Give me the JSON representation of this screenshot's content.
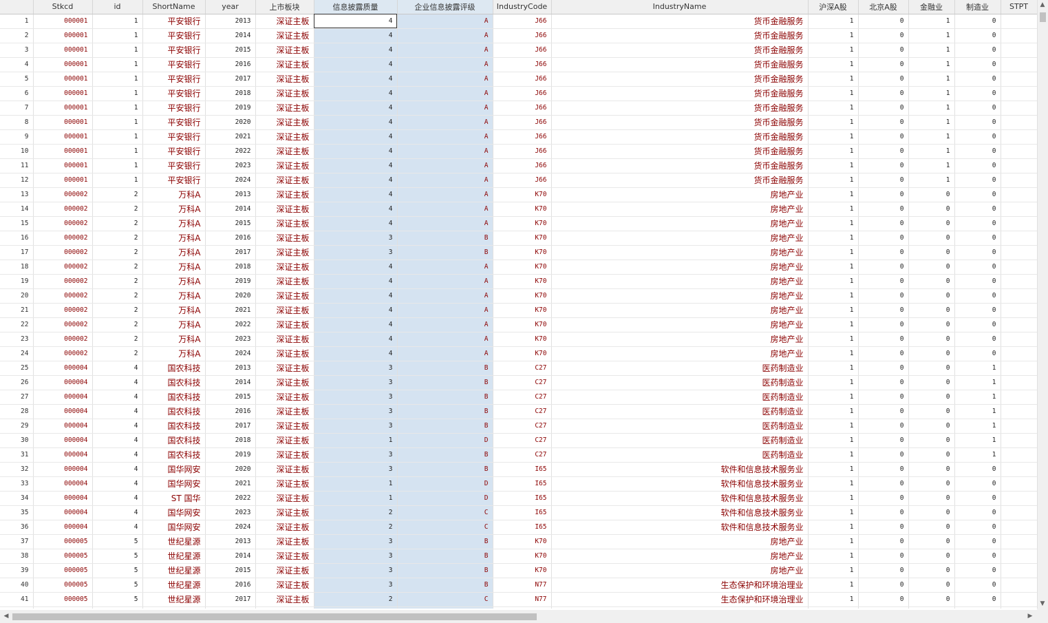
{
  "columns": [
    {
      "key": "rownum",
      "label": ""
    },
    {
      "key": "Stkcd",
      "label": "Stkcd"
    },
    {
      "key": "id",
      "label": "id"
    },
    {
      "key": "ShortName",
      "label": "ShortName"
    },
    {
      "key": "year",
      "label": "year"
    },
    {
      "key": "board",
      "label": "上市板块"
    },
    {
      "key": "quality",
      "label": "信息披露质量"
    },
    {
      "key": "rating",
      "label": "企业信息披露评级"
    },
    {
      "key": "IndustryCode",
      "label": "IndustryCode"
    },
    {
      "key": "IndustryName",
      "label": "IndustryName"
    },
    {
      "key": "hushen",
      "label": "沪深A股"
    },
    {
      "key": "beijing",
      "label": "北京A股"
    },
    {
      "key": "finance",
      "label": "金融业"
    },
    {
      "key": "manufacturing",
      "label": "制造业"
    },
    {
      "key": "STPT",
      "label": "STPT"
    }
  ],
  "selected_columns": [
    "quality",
    "rating"
  ],
  "active_cell": {
    "row": 1,
    "col": "quality"
  },
  "rows": [
    [
      "1",
      "000001",
      "1",
      "平安银行",
      "2013",
      "深证主板",
      "4",
      "A",
      "J66",
      "货币金融服务",
      "1",
      "0",
      "1",
      "0",
      ""
    ],
    [
      "2",
      "000001",
      "1",
      "平安银行",
      "2014",
      "深证主板",
      "4",
      "A",
      "J66",
      "货币金融服务",
      "1",
      "0",
      "1",
      "0",
      ""
    ],
    [
      "3",
      "000001",
      "1",
      "平安银行",
      "2015",
      "深证主板",
      "4",
      "A",
      "J66",
      "货币金融服务",
      "1",
      "0",
      "1",
      "0",
      ""
    ],
    [
      "4",
      "000001",
      "1",
      "平安银行",
      "2016",
      "深证主板",
      "4",
      "A",
      "J66",
      "货币金融服务",
      "1",
      "0",
      "1",
      "0",
      ""
    ],
    [
      "5",
      "000001",
      "1",
      "平安银行",
      "2017",
      "深证主板",
      "4",
      "A",
      "J66",
      "货币金融服务",
      "1",
      "0",
      "1",
      "0",
      ""
    ],
    [
      "6",
      "000001",
      "1",
      "平安银行",
      "2018",
      "深证主板",
      "4",
      "A",
      "J66",
      "货币金融服务",
      "1",
      "0",
      "1",
      "0",
      ""
    ],
    [
      "7",
      "000001",
      "1",
      "平安银行",
      "2019",
      "深证主板",
      "4",
      "A",
      "J66",
      "货币金融服务",
      "1",
      "0",
      "1",
      "0",
      ""
    ],
    [
      "8",
      "000001",
      "1",
      "平安银行",
      "2020",
      "深证主板",
      "4",
      "A",
      "J66",
      "货币金融服务",
      "1",
      "0",
      "1",
      "0",
      ""
    ],
    [
      "9",
      "000001",
      "1",
      "平安银行",
      "2021",
      "深证主板",
      "4",
      "A",
      "J66",
      "货币金融服务",
      "1",
      "0",
      "1",
      "0",
      ""
    ],
    [
      "10",
      "000001",
      "1",
      "平安银行",
      "2022",
      "深证主板",
      "4",
      "A",
      "J66",
      "货币金融服务",
      "1",
      "0",
      "1",
      "0",
      ""
    ],
    [
      "11",
      "000001",
      "1",
      "平安银行",
      "2023",
      "深证主板",
      "4",
      "A",
      "J66",
      "货币金融服务",
      "1",
      "0",
      "1",
      "0",
      ""
    ],
    [
      "12",
      "000001",
      "1",
      "平安银行",
      "2024",
      "深证主板",
      "4",
      "A",
      "J66",
      "货币金融服务",
      "1",
      "0",
      "1",
      "0",
      ""
    ],
    [
      "13",
      "000002",
      "2",
      "万科A",
      "2013",
      "深证主板",
      "4",
      "A",
      "K70",
      "房地产业",
      "1",
      "0",
      "0",
      "0",
      ""
    ],
    [
      "14",
      "000002",
      "2",
      "万科A",
      "2014",
      "深证主板",
      "4",
      "A",
      "K70",
      "房地产业",
      "1",
      "0",
      "0",
      "0",
      ""
    ],
    [
      "15",
      "000002",
      "2",
      "万科A",
      "2015",
      "深证主板",
      "4",
      "A",
      "K70",
      "房地产业",
      "1",
      "0",
      "0",
      "0",
      ""
    ],
    [
      "16",
      "000002",
      "2",
      "万科A",
      "2016",
      "深证主板",
      "3",
      "B",
      "K70",
      "房地产业",
      "1",
      "0",
      "0",
      "0",
      ""
    ],
    [
      "17",
      "000002",
      "2",
      "万科A",
      "2017",
      "深证主板",
      "3",
      "B",
      "K70",
      "房地产业",
      "1",
      "0",
      "0",
      "0",
      ""
    ],
    [
      "18",
      "000002",
      "2",
      "万科A",
      "2018",
      "深证主板",
      "4",
      "A",
      "K70",
      "房地产业",
      "1",
      "0",
      "0",
      "0",
      ""
    ],
    [
      "19",
      "000002",
      "2",
      "万科A",
      "2019",
      "深证主板",
      "4",
      "A",
      "K70",
      "房地产业",
      "1",
      "0",
      "0",
      "0",
      ""
    ],
    [
      "20",
      "000002",
      "2",
      "万科A",
      "2020",
      "深证主板",
      "4",
      "A",
      "K70",
      "房地产业",
      "1",
      "0",
      "0",
      "0",
      ""
    ],
    [
      "21",
      "000002",
      "2",
      "万科A",
      "2021",
      "深证主板",
      "4",
      "A",
      "K70",
      "房地产业",
      "1",
      "0",
      "0",
      "0",
      ""
    ],
    [
      "22",
      "000002",
      "2",
      "万科A",
      "2022",
      "深证主板",
      "4",
      "A",
      "K70",
      "房地产业",
      "1",
      "0",
      "0",
      "0",
      ""
    ],
    [
      "23",
      "000002",
      "2",
      "万科A",
      "2023",
      "深证主板",
      "4",
      "A",
      "K70",
      "房地产业",
      "1",
      "0",
      "0",
      "0",
      ""
    ],
    [
      "24",
      "000002",
      "2",
      "万科A",
      "2024",
      "深证主板",
      "4",
      "A",
      "K70",
      "房地产业",
      "1",
      "0",
      "0",
      "0",
      ""
    ],
    [
      "25",
      "000004",
      "4",
      "国农科技",
      "2013",
      "深证主板",
      "3",
      "B",
      "C27",
      "医药制造业",
      "1",
      "0",
      "0",
      "1",
      ""
    ],
    [
      "26",
      "000004",
      "4",
      "国农科技",
      "2014",
      "深证主板",
      "3",
      "B",
      "C27",
      "医药制造业",
      "1",
      "0",
      "0",
      "1",
      ""
    ],
    [
      "27",
      "000004",
      "4",
      "国农科技",
      "2015",
      "深证主板",
      "3",
      "B",
      "C27",
      "医药制造业",
      "1",
      "0",
      "0",
      "1",
      ""
    ],
    [
      "28",
      "000004",
      "4",
      "国农科技",
      "2016",
      "深证主板",
      "3",
      "B",
      "C27",
      "医药制造业",
      "1",
      "0",
      "0",
      "1",
      ""
    ],
    [
      "29",
      "000004",
      "4",
      "国农科技",
      "2017",
      "深证主板",
      "3",
      "B",
      "C27",
      "医药制造业",
      "1",
      "0",
      "0",
      "1",
      ""
    ],
    [
      "30",
      "000004",
      "4",
      "国农科技",
      "2018",
      "深证主板",
      "1",
      "D",
      "C27",
      "医药制造业",
      "1",
      "0",
      "0",
      "1",
      ""
    ],
    [
      "31",
      "000004",
      "4",
      "国农科技",
      "2019",
      "深证主板",
      "3",
      "B",
      "C27",
      "医药制造业",
      "1",
      "0",
      "0",
      "1",
      ""
    ],
    [
      "32",
      "000004",
      "4",
      "国华网安",
      "2020",
      "深证主板",
      "3",
      "B",
      "I65",
      "软件和信息技术服务业",
      "1",
      "0",
      "0",
      "0",
      ""
    ],
    [
      "33",
      "000004",
      "4",
      "国华网安",
      "2021",
      "深证主板",
      "1",
      "D",
      "I65",
      "软件和信息技术服务业",
      "1",
      "0",
      "0",
      "0",
      ""
    ],
    [
      "34",
      "000004",
      "4",
      "ST 国华",
      "2022",
      "深证主板",
      "1",
      "D",
      "I65",
      "软件和信息技术服务业",
      "1",
      "0",
      "0",
      "0",
      ""
    ],
    [
      "35",
      "000004",
      "4",
      "国华网安",
      "2023",
      "深证主板",
      "2",
      "C",
      "I65",
      "软件和信息技术服务业",
      "1",
      "0",
      "0",
      "0",
      ""
    ],
    [
      "36",
      "000004",
      "4",
      "国华网安",
      "2024",
      "深证主板",
      "2",
      "C",
      "I65",
      "软件和信息技术服务业",
      "1",
      "0",
      "0",
      "0",
      ""
    ],
    [
      "37",
      "000005",
      "5",
      "世纪星源",
      "2013",
      "深证主板",
      "3",
      "B",
      "K70",
      "房地产业",
      "1",
      "0",
      "0",
      "0",
      ""
    ],
    [
      "38",
      "000005",
      "5",
      "世纪星源",
      "2014",
      "深证主板",
      "3",
      "B",
      "K70",
      "房地产业",
      "1",
      "0",
      "0",
      "0",
      ""
    ],
    [
      "39",
      "000005",
      "5",
      "世纪星源",
      "2015",
      "深证主板",
      "3",
      "B",
      "K70",
      "房地产业",
      "1",
      "0",
      "0",
      "0",
      ""
    ],
    [
      "40",
      "000005",
      "5",
      "世纪星源",
      "2016",
      "深证主板",
      "3",
      "B",
      "N77",
      "生态保护和环境治理业",
      "1",
      "0",
      "0",
      "0",
      ""
    ],
    [
      "41",
      "000005",
      "5",
      "世纪星源",
      "2017",
      "深证主板",
      "2",
      "C",
      "N77",
      "生态保护和环境治理业",
      "1",
      "0",
      "0",
      "0",
      ""
    ],
    [
      "",
      "",
      "",
      "世纪星源",
      "",
      "深证主板",
      "",
      "",
      "",
      "生态保护和环境治理业",
      "",
      "",
      "",
      "",
      ""
    ]
  ],
  "scrollbars": {
    "up_arrow": "▲",
    "down_arrow": "▼",
    "left_arrow": "◀",
    "right_arrow": "▶"
  },
  "colors": {
    "string_text": "#8b0000",
    "selected_column_bg": "#d5e3f1",
    "header_bg": "#f0f0f0"
  }
}
